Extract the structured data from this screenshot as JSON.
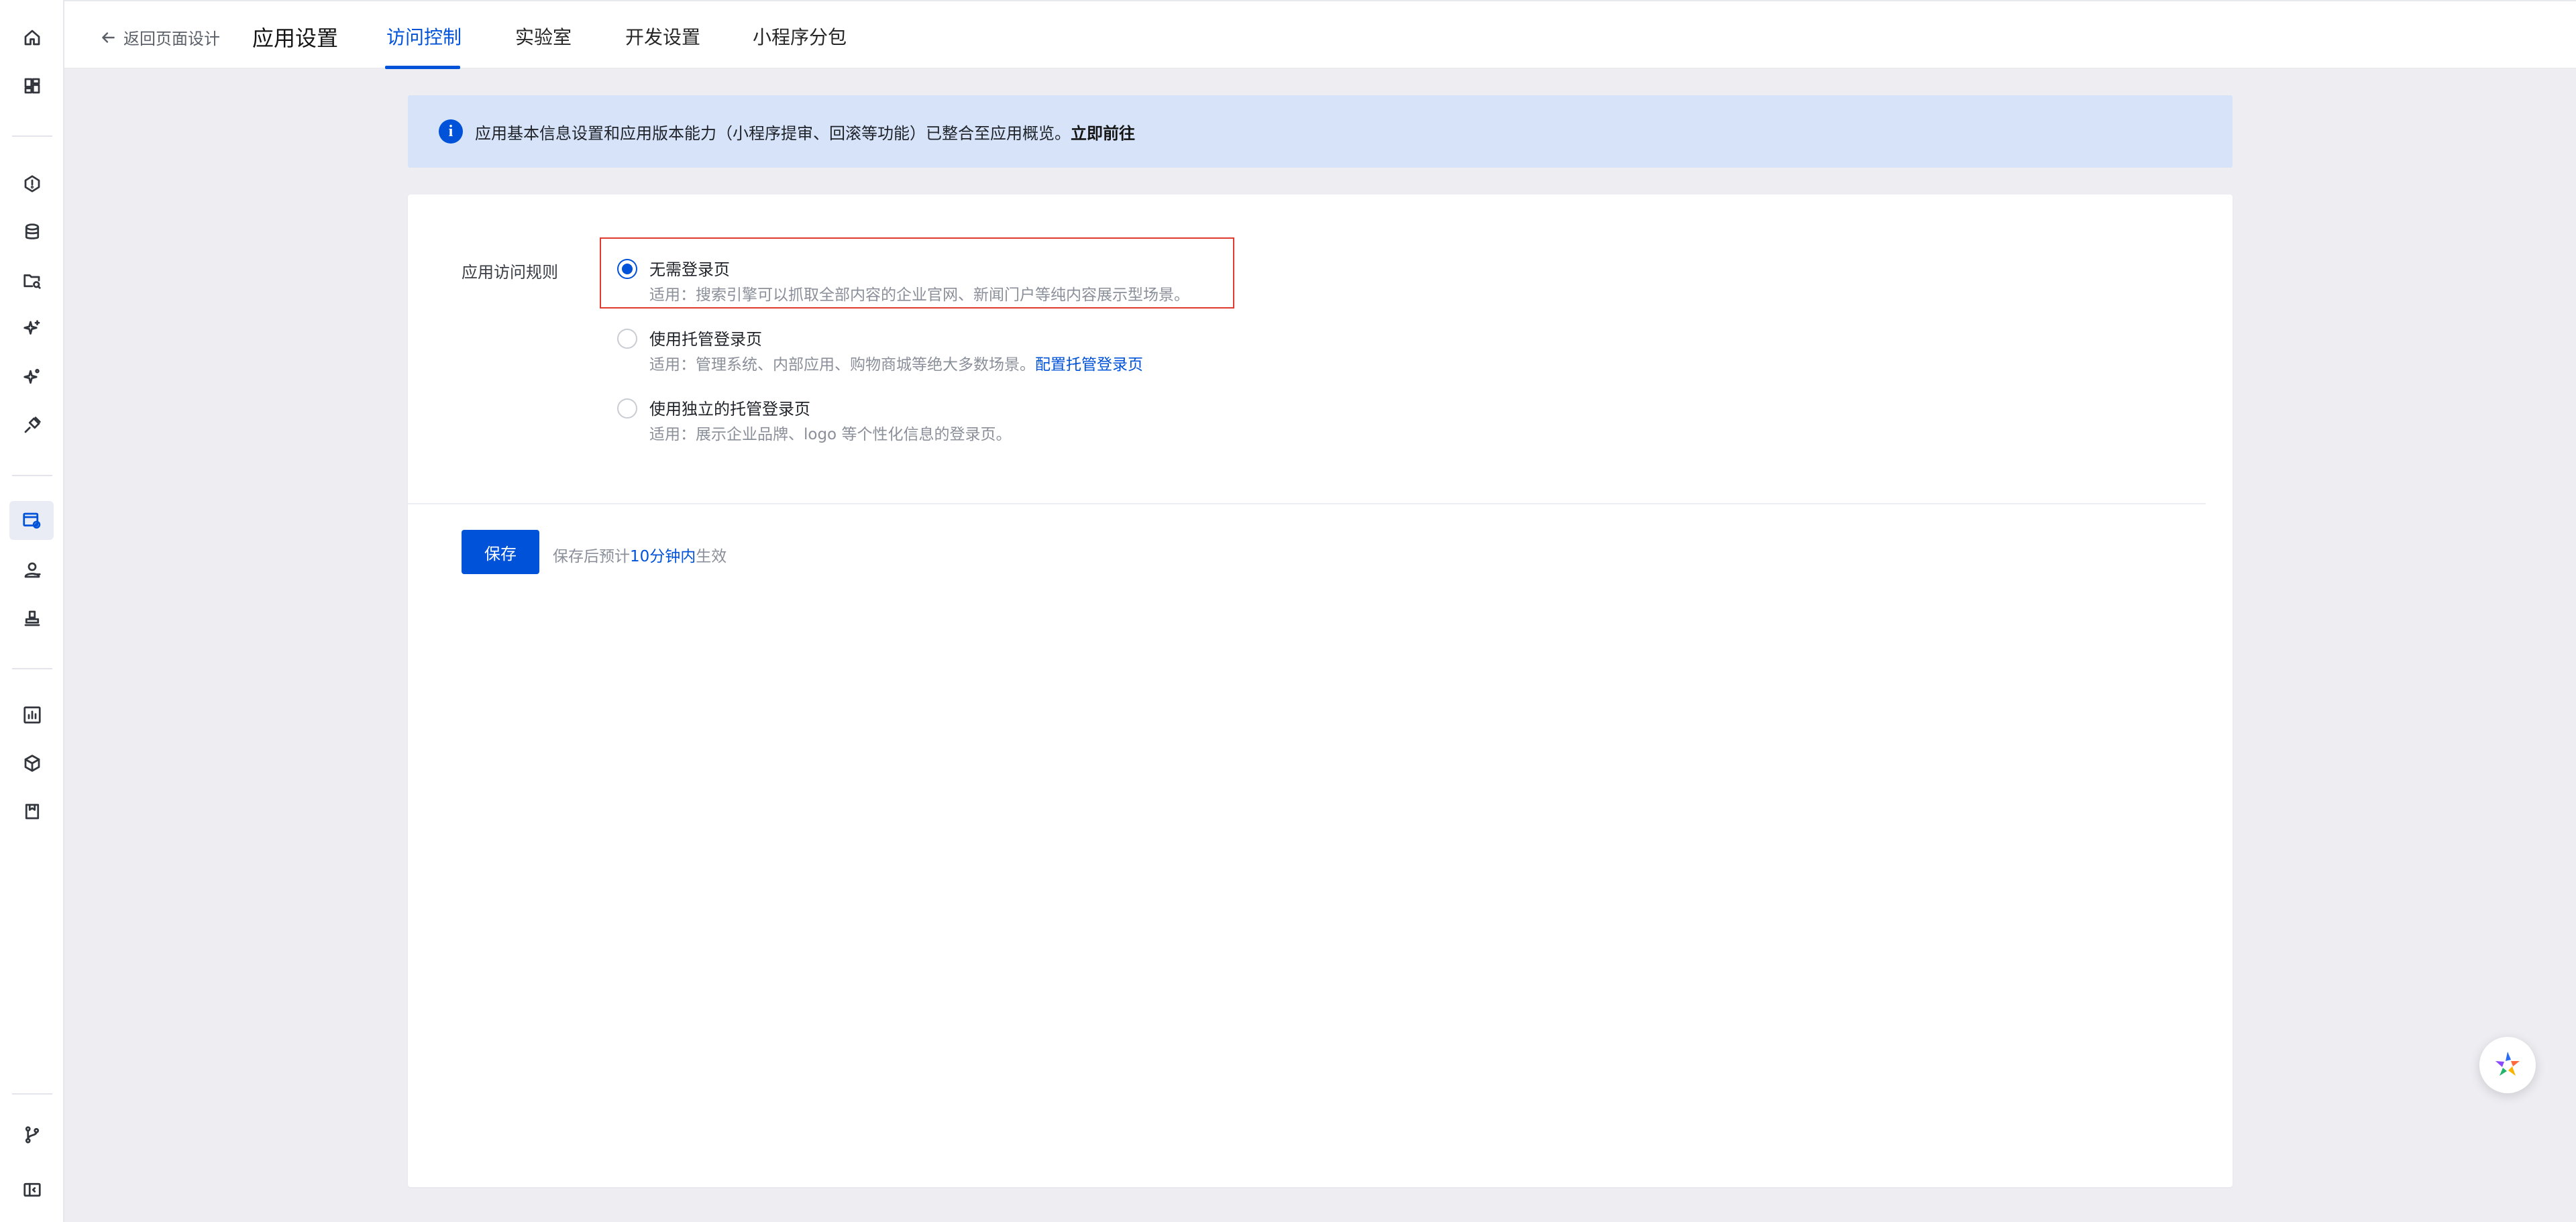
{
  "sidebar": {
    "items": [
      {
        "icon": "home-icon"
      },
      {
        "icon": "dashboard-icon"
      },
      {
        "icon": "shield-icon"
      },
      {
        "icon": "database-icon"
      },
      {
        "icon": "folder-search-icon"
      },
      {
        "icon": "sparkle-icon"
      },
      {
        "icon": "sparkle-alt-icon"
      },
      {
        "icon": "plug-icon"
      },
      {
        "icon": "app-settings-icon",
        "active": true
      },
      {
        "icon": "users-icon"
      },
      {
        "icon": "stamp-icon"
      },
      {
        "icon": "chart-icon"
      },
      {
        "icon": "cube-icon"
      },
      {
        "icon": "package-icon"
      },
      {
        "icon": "branch-icon"
      },
      {
        "icon": "collapse-icon"
      }
    ]
  },
  "header": {
    "back_label": "返回页面设计",
    "title": "应用设置",
    "tabs": [
      {
        "label": "访问控制",
        "active": true
      },
      {
        "label": "实验室",
        "active": false
      },
      {
        "label": "开发设置",
        "active": false
      },
      {
        "label": "小程序分包",
        "active": false
      }
    ]
  },
  "banner": {
    "text": "应用基本信息设置和应用版本能力（小程序提审、回滚等功能）已整合至应用概览。",
    "link": "立即前往"
  },
  "access_rule": {
    "label": "应用访问规则",
    "options": [
      {
        "title": "无需登录页",
        "desc": "适用：搜索引擎可以抓取全部内容的企业官网、新闻门户等纯内容展示型场景。",
        "link": "",
        "selected": true
      },
      {
        "title": "使用托管登录页",
        "desc": "适用：管理系统、内部应用、购物商城等绝大多数场景。",
        "link": "配置托管登录页",
        "selected": false
      },
      {
        "title": "使用独立的托管登录页",
        "desc": "适用：展示企业品牌、logo 等个性化信息的登录页。",
        "link": "",
        "selected": false
      }
    ]
  },
  "footer": {
    "save_label": "保存",
    "hint_prefix": "保存后预计",
    "hint_highlight": "10分钟内",
    "hint_suffix": "生效"
  },
  "colors": {
    "accent": "#0052d9",
    "banner_bg": "#d6e3f9",
    "highlight_border": "#e0392f",
    "page_bg": "#ededf2"
  }
}
